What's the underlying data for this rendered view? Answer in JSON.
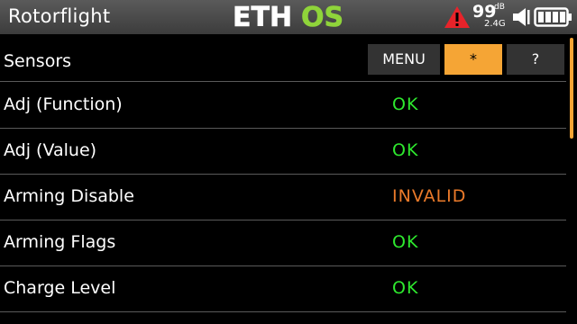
{
  "header": {
    "title": "Rotorflight",
    "logo_text": "ETHOS",
    "rssi_value": "99",
    "rssi_unit": "dB",
    "rssi_band": "2.4G",
    "icons": [
      "warning-icon",
      "speaker-icon",
      "battery-icon"
    ]
  },
  "toolbar": {
    "section_label": "Sensors",
    "menu_label": "MENU",
    "star_label": "*",
    "help_label": "?"
  },
  "rows": [
    {
      "label": "Adj (Function)",
      "value": "OK",
      "status": "ok"
    },
    {
      "label": "Adj (Value)",
      "value": "OK",
      "status": "ok"
    },
    {
      "label": "Arming Disable",
      "value": "INVALID",
      "status": "invalid"
    },
    {
      "label": "Arming Flags",
      "value": "OK",
      "status": "ok"
    },
    {
      "label": "Charge Level",
      "value": "OK",
      "status": "ok"
    }
  ],
  "colors": {
    "ok": "#2ee82e",
    "invalid": "#ea7a2a",
    "accent": "#f5a535",
    "logo_green": "#8fd43a"
  }
}
